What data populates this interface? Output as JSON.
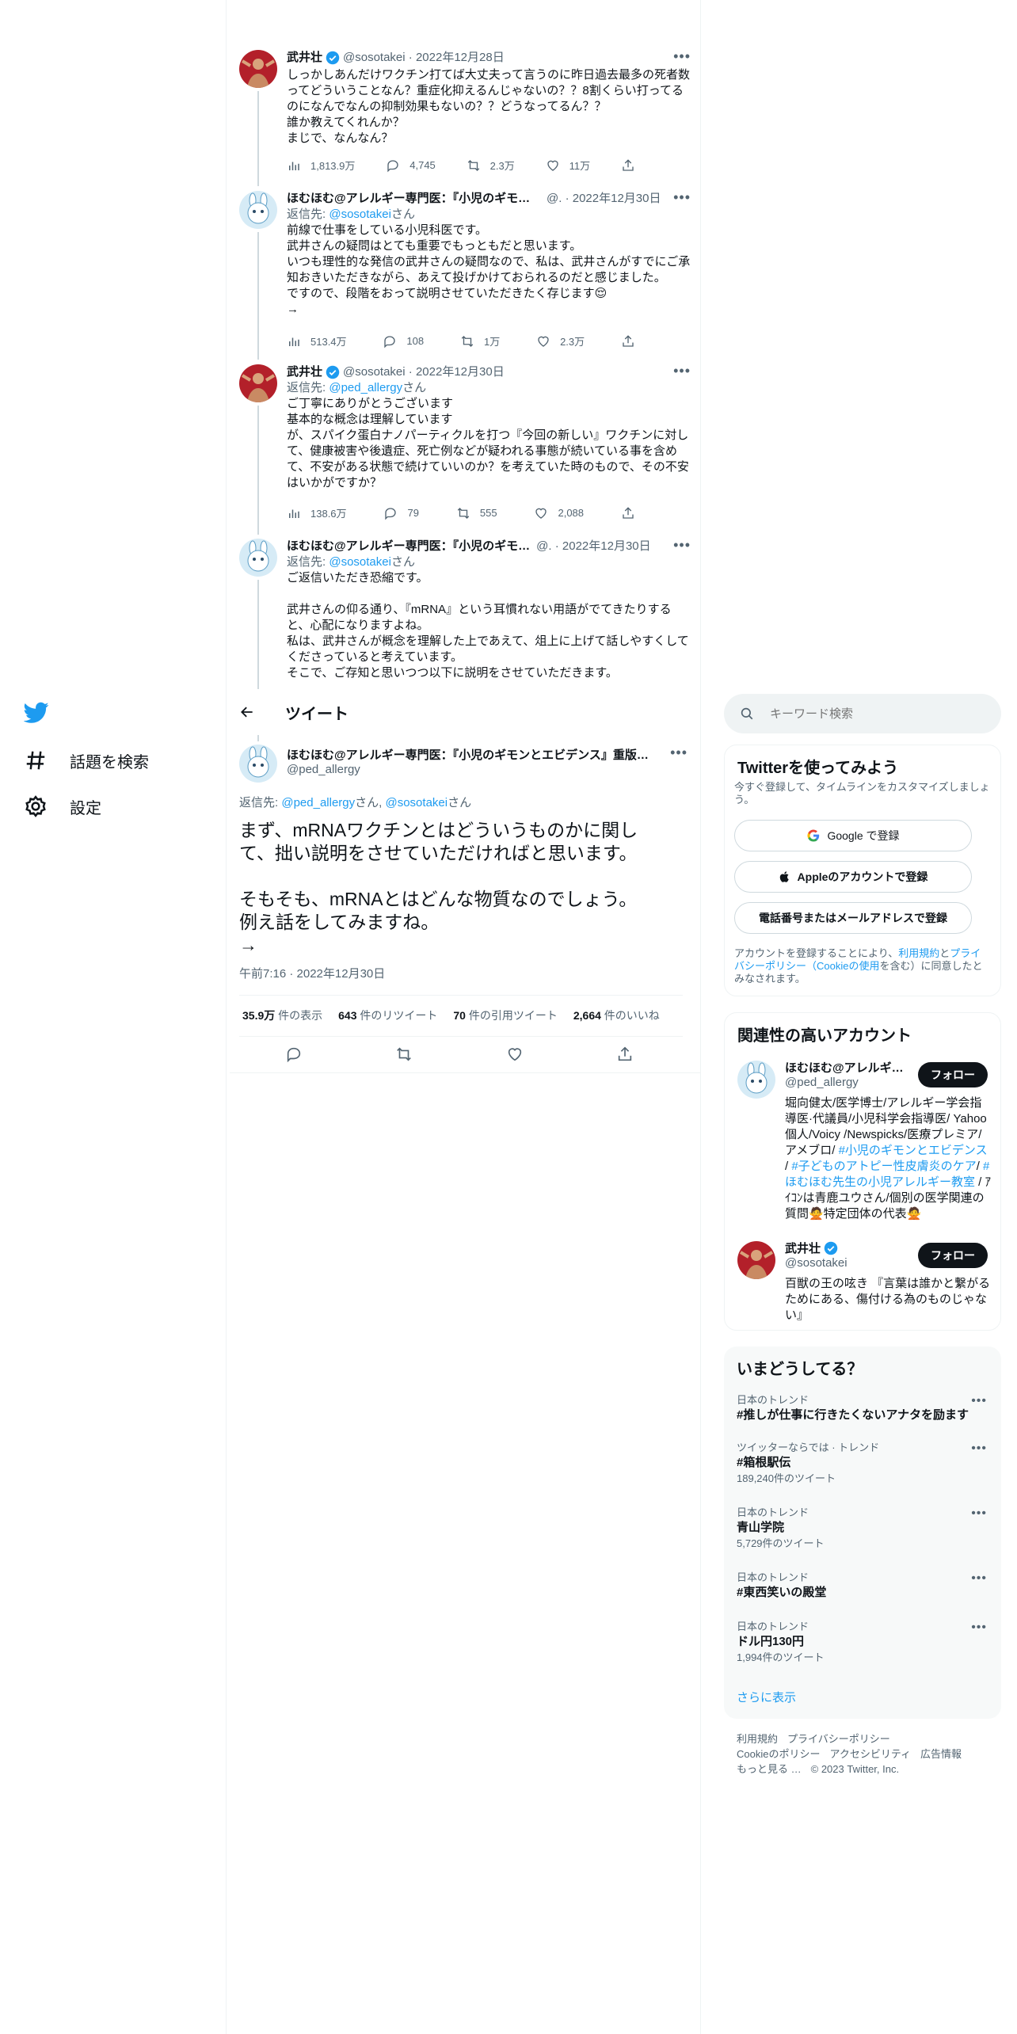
{
  "colors": {
    "accent": "#1d9bf0",
    "text": "#0f1419",
    "muted": "#536471",
    "verified": "#1d9bf0"
  },
  "nav": {
    "logo_icon": "twitter-bird-icon",
    "explore_label": "話題を検索",
    "settings_label": "設定"
  },
  "thread": [
    {
      "name": "武井壮",
      "handle": "@sosotakei",
      "date": "2022年12月28日",
      "reply_prefix": "",
      "reply_to": "",
      "reply_suffix": "",
      "text": "しっかしあんだけワクチン打てば大丈夫って言うのに昨日過去最多の死者数ってどういうことなん？重症化抑えるんじゃないの？？8割くらい打ってるのになんでなんの抑制効果もないの？？どうなってるん？？\n誰か教えてくれんか？\nまじで、なんなん？",
      "views": "1,813.9万",
      "replies": "4,745",
      "retweets": "2.3万",
      "likes": "11万"
    },
    {
      "name": "ほむほむ@アレルギー専門医：『小児のギモン…",
      "handle": "@.",
      "date": "2022年12月30日",
      "reply_prefix": "返信先: ",
      "reply_to": "@sosotakei",
      "reply_suffix": "さん",
      "text": "前線で仕事をしている小児科医です。\n武井さんの疑問はとても重要でもっともだと思います。\nいつも理性的な発信の武井さんの疑問なので、私は、武井さんがすでにご承知おきいただきながら、あえて投げかけておられるのだと感じました。\nですので、段階をおって説明させていただきたく存じます😌\n→",
      "views": "513.4万",
      "replies": "108",
      "retweets": "1万",
      "likes": "2.3万"
    },
    {
      "name": "武井壮",
      "handle": "@sosotakei",
      "date": "2022年12月30日",
      "reply_prefix": "返信先: ",
      "reply_to": "@ped_allergy",
      "reply_suffix": "さん",
      "text": "ご丁寧にありがとうございます\n基本的な概念は理解しています\nが、スパイク蛋白ナノパーティクルを打つ『今回の新しい』ワクチンに対して、健康被害や後遺症、死亡例などが疑われる事態が続いている事を含めて、不安がある状態で続けていいのか？を考えていた時のもので、その不安はいかがですか？",
      "views": "138.6万",
      "replies": "79",
      "retweets": "555",
      "likes": "2,088"
    },
    {
      "name": "ほむほむ@アレルギー専門医：『小児のギモ…",
      "handle": "@.",
      "date": "2022年12月30日",
      "reply_prefix": "返信先: ",
      "reply_to": "@sosotakei",
      "reply_suffix": "さん",
      "text": "ご返信いただき恐縮です。\n\n武井さんの仰る通り、『mRNA』という耳慣れない用語がでてきたりすると、心配になりますよね。\n私は、武井さんが概念を理解した上であえて、俎上に上げて話しやすくしてくださっていると考えています。\nそこで、ご存知と思いつつ以下に説明をさせていただきます。",
      "views": "",
      "replies": "",
      "retweets": "",
      "likes": ""
    }
  ],
  "header": {
    "title": "ツイート"
  },
  "main_tweet": {
    "name": "ほむほむ@アレルギー専門医：『小児のギモンとエビデンス』重版…",
    "handle": "@ped_allergy",
    "reply_prefix": "返信先: ",
    "reply_to_1": "@ped_allergy",
    "reply_mid": "さん, ",
    "reply_to_2": "@sosotakei",
    "reply_suffix": "さん",
    "text": "まず、mRNAワクチンとはどういうものかに関して、拙い説明をさせていただければと思います。\n\nそもそも、mRNAとはどんな物質なのでしょう。\n例え話をしてみますね。\n→",
    "time": "午前7:16 · 2022年12月30日",
    "stats": [
      {
        "num": "35.9万",
        "label": " 件の表示"
      },
      {
        "num": "643",
        "label": " 件のリツイート"
      },
      {
        "num": "70",
        "label": " 件の引用ツイート"
      },
      {
        "num": "2,664",
        "label": " 件のいいね"
      }
    ]
  },
  "search": {
    "placeholder": "キーワード検索"
  },
  "signup": {
    "title": "Twitterを使ってみよう",
    "subtitle": "今すぐ登録して、タイムラインをカスタマイズしましょう。",
    "google_btn": "Google で登録",
    "apple_btn": "Appleのアカウントで登録",
    "phone_btn": "電話番号またはメールアドレスで登録",
    "terms_1": "アカウントを登録することにより、",
    "terms_link_1": "利用規約",
    "terms_2": "と",
    "terms_link_2": "プライバシーポリシー（Cookieの使用",
    "terms_3": "を含む）に同意したとみなされます。"
  },
  "related": {
    "title": "関連性の高いアカウント",
    "follow_label": "フォロー",
    "accounts": [
      {
        "name": "ほむほむ@アレルギ…",
        "handle": "@ped_allergy",
        "bio_1": "堀向健太/医学博士/アレルギー学会指導医·代議員/小児科学会指導医/ Yahoo個人/Voicy /Newspicks/医療プレミア/アメブロ/ ",
        "bio_link_1": "#小児のギモンとエビデンス",
        "bio_2": " / ",
        "bio_link_2": "#子どものアトピー性皮膚炎のケア",
        "bio_3": "/ ",
        "bio_link_3": "#ほむほむ先生の小児アレルギー教室",
        "bio_4": " / ｱｲｺﾝは青鹿ユウさん/個別の医学関連の質問🙅特定団体の代表🙅"
      },
      {
        "name": "武井壮",
        "handle": "@sosotakei",
        "bio": "百獣の王の呟き 『言葉は誰かと繋がるためにある、傷付ける為のものじゃない』"
      }
    ]
  },
  "trends": {
    "title": "いまどうしてる？",
    "items": [
      {
        "category": "日本のトレンド",
        "title": "#推しが仕事に行きたくないアナタを励ます",
        "count": ""
      },
      {
        "category": "ツイッターならでは · トレンド",
        "title": "#箱根駅伝",
        "count": "189,240件のツイート"
      },
      {
        "category": "日本のトレンド",
        "title": "青山学院",
        "count": "5,729件のツイート"
      },
      {
        "category": "日本のトレンド",
        "title": "#東西笑いの殿堂",
        "count": ""
      },
      {
        "category": "日本のトレンド",
        "title": "ドル円130円",
        "count": "1,994件のツイート"
      }
    ],
    "show_more": "さらに表示"
  },
  "footer": {
    "links_1": [
      "利用規約",
      "プライバシーポリシー"
    ],
    "links_2": [
      "Cookieのポリシー",
      "アクセシビリティ",
      "広告情報"
    ],
    "more": "もっと見る …",
    "copyright": "© 2023 Twitter, Inc."
  }
}
